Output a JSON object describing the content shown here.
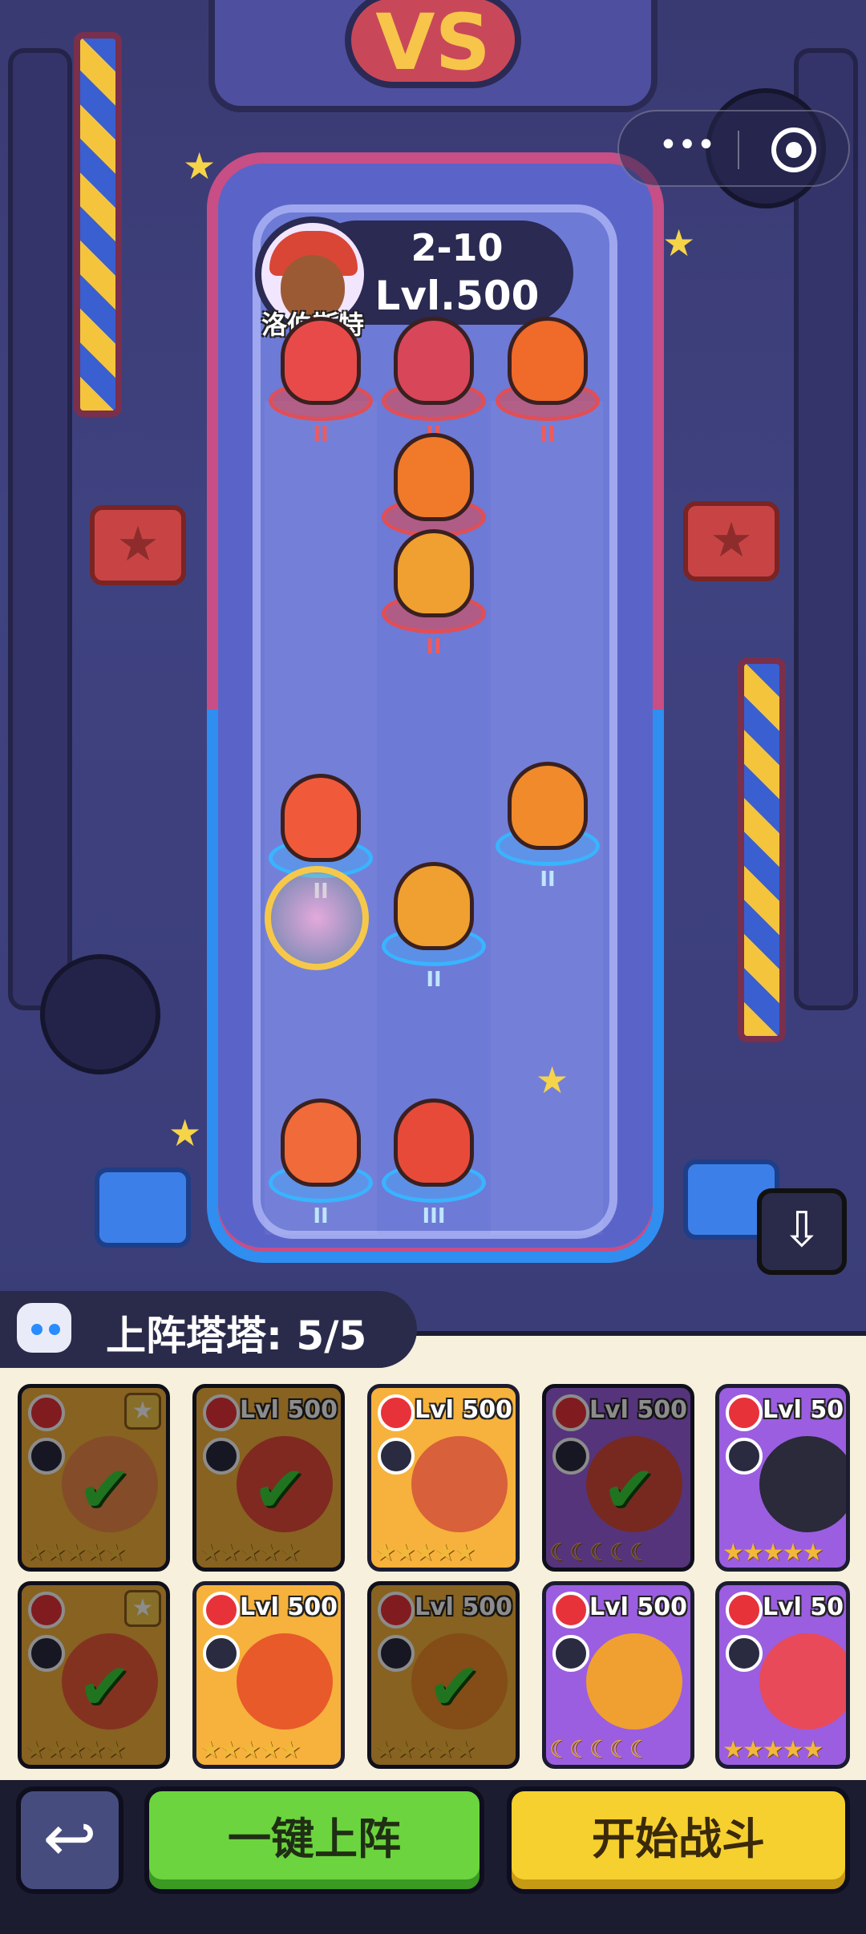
{
  "battle": {
    "stage": "2-10",
    "enemy_level": "Lvl.500",
    "enemy_name": "洛伯斯特",
    "vs_text": "VS"
  },
  "enemy_units": [
    {
      "tier": "II",
      "color": "#e84a4a"
    },
    {
      "tier": "II",
      "color": "#d8465a"
    },
    {
      "tier": "II",
      "color": "#f06a2a"
    },
    {
      "tier": "",
      "color": "#f07a2a"
    },
    {
      "tier": "II",
      "color": "#f0a030"
    }
  ],
  "ally_units": [
    {
      "tier": "II",
      "color": "#f05a3a"
    },
    {
      "tier": "II",
      "color": "#f08a2a"
    },
    {
      "tier": "II",
      "color": "#f0a030"
    },
    {
      "tier": "II",
      "color": "#f06a3a"
    },
    {
      "tier": "III",
      "color": "#e84a3a"
    }
  ],
  "deploy": {
    "label": "上阵塔塔: 5/5"
  },
  "cards": [
    {
      "level": "",
      "rarity": "orange",
      "deployed": true,
      "stars": "★★★★★"
    },
    {
      "level": "Lvl 500",
      "rarity": "orange",
      "deployed": true,
      "stars": "★★★★★"
    },
    {
      "level": "Lvl 500",
      "rarity": "orange",
      "deployed": false,
      "stars": "★★★★★"
    },
    {
      "level": "Lvl 500",
      "rarity": "purple",
      "deployed": true,
      "stars": "☾☾☾☾☾"
    },
    {
      "level": "Lvl 50",
      "rarity": "purple",
      "deployed": false,
      "stars": "★★★★★"
    },
    {
      "level": "",
      "rarity": "orange",
      "deployed": true,
      "stars": "★★★★★"
    },
    {
      "level": "Lvl 500",
      "rarity": "orange",
      "deployed": false,
      "stars": "★★★★★"
    },
    {
      "level": "Lvl 500",
      "rarity": "orange",
      "deployed": true,
      "stars": "★★★★★"
    },
    {
      "level": "Lvl 500",
      "rarity": "purple",
      "deployed": false,
      "stars": "☾☾☾☾☾"
    },
    {
      "level": "Lvl 50",
      "rarity": "purple",
      "deployed": false,
      "stars": "★★★★★"
    }
  ],
  "buttons": {
    "back_icon": "↩",
    "auto_deploy": "一键上阵",
    "start_battle": "开始战斗",
    "download_icon": "⇩"
  },
  "capsule": {
    "more_icon": "•••"
  },
  "colors": {
    "accent_green": "#6cd43e",
    "accent_yellow": "#f6d02e",
    "enemy_red": "#e14e56",
    "ally_blue": "#39b4ff"
  }
}
